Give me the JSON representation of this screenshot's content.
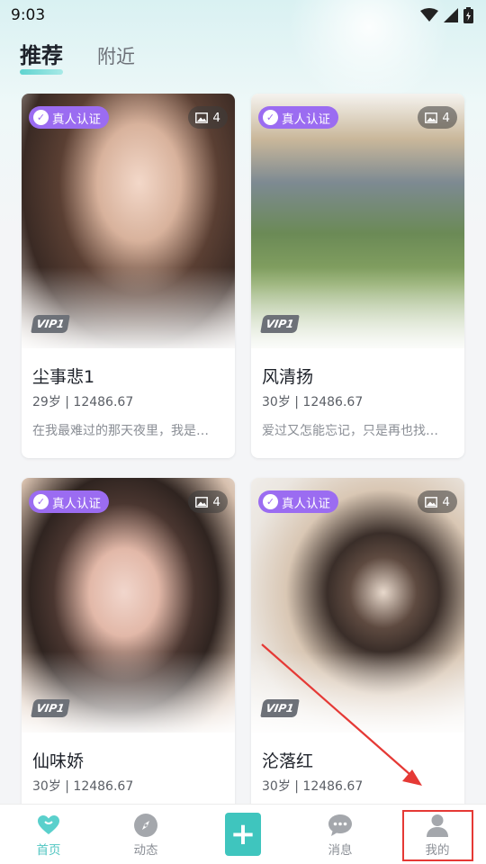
{
  "status_bar": {
    "time": "9:03"
  },
  "tabs": [
    {
      "label": "推荐",
      "active": true
    },
    {
      "label": "附近",
      "active": false
    }
  ],
  "cards": [
    {
      "verified_label": "真人认证",
      "photo_count": "4",
      "vip_label": "VIP1",
      "name": "尘事悲1",
      "meta": "29岁 | 12486.67",
      "bio": "在我最难过的那天夜里，我是…"
    },
    {
      "verified_label": "真人认证",
      "photo_count": "4",
      "vip_label": "VIP1",
      "name": "风清扬",
      "meta": "30岁 | 12486.67",
      "bio": "爱过又怎能忘记，只是再也找…"
    },
    {
      "verified_label": "真人认证",
      "photo_count": "4",
      "vip_label": "VIP1",
      "name": "仙味娇",
      "meta": "30岁 | 12486.67",
      "bio": ""
    },
    {
      "verified_label": "真人认证",
      "photo_count": "4",
      "vip_label": "VIP1",
      "name": "沦落红",
      "meta": "30岁 | 12486.67",
      "bio": ""
    }
  ],
  "bottom_nav": [
    {
      "label": "首页",
      "icon": "home-heart-icon",
      "active": true
    },
    {
      "label": "动态",
      "icon": "compass-icon",
      "active": false
    },
    {
      "label": "",
      "icon": "plus-icon",
      "active": false
    },
    {
      "label": "消息",
      "icon": "chat-bubble-icon",
      "active": false
    },
    {
      "label": "我的",
      "icon": "person-icon",
      "active": false
    }
  ],
  "colors": {
    "accent": "#4fc5c1",
    "verified_badge": "#9b6cf1",
    "annotation": "#e53935"
  }
}
